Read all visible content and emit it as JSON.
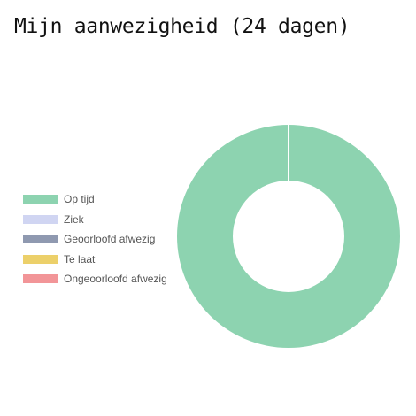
{
  "page": {
    "title": "Mijn aanwezigheid (24 dagen)"
  },
  "chart_data": {
    "type": "pie",
    "variant": "doughnut",
    "title": "Mijn aanwezigheid (24 dagen)",
    "categories": [
      "Op tijd",
      "Ziek",
      "Geoorloofd afwezig",
      "Te laat",
      "Ongeoorloofd afwezig"
    ],
    "values": [
      24,
      0,
      0,
      0,
      0
    ],
    "colors": [
      "#8dd3b0",
      "#d0d5f2",
      "#8f99b0",
      "#ecd06a",
      "#f29598"
    ],
    "legend": "left"
  }
}
